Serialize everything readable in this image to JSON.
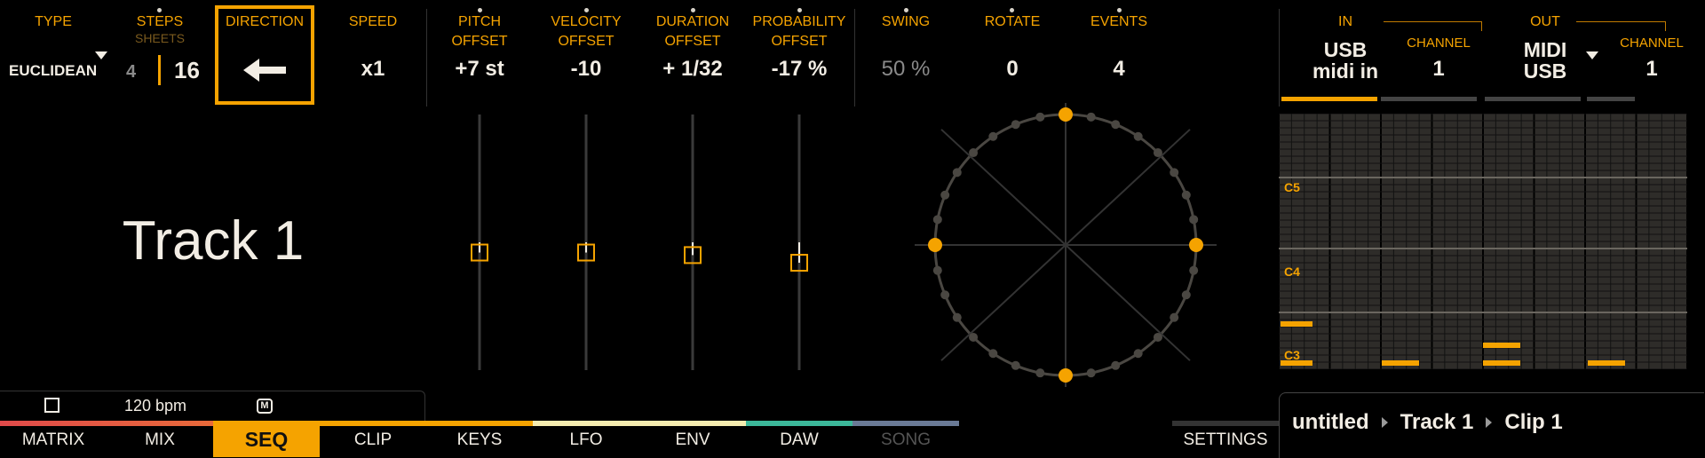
{
  "colors": {
    "accent": "#f5a300",
    "text": "#f2ede4",
    "dim": "#8a8a8a",
    "bg": "#000000"
  },
  "params": {
    "type": {
      "label": "TYPE",
      "value": "EUCLIDEAN"
    },
    "steps": {
      "label": "STEPS",
      "sublabel": "SHEETS",
      "sheets": "4",
      "steps": "16"
    },
    "direction": {
      "label": "DIRECTION",
      "icon": "arrow-left-icon"
    },
    "speed": {
      "label": "SPEED",
      "value": "x1"
    },
    "pitch": {
      "label1": "PITCH",
      "label2": "OFFSET",
      "value": "+7 st"
    },
    "velocity": {
      "label1": "VELOCITY",
      "label2": "OFFSET",
      "value": "-10"
    },
    "duration": {
      "label1": "DURATION",
      "label2": "OFFSET",
      "value": "+ 1/32"
    },
    "probability": {
      "label1": "PROBABILITY",
      "label2": "OFFSET",
      "value": "-17 %"
    },
    "swing": {
      "label": "SWING",
      "value": "50 %"
    },
    "rotate": {
      "label": "ROTATE",
      "value": "0"
    },
    "events": {
      "label": "EVENTS",
      "value": "4"
    }
  },
  "io": {
    "in_label": "IN",
    "in_value1": "USB",
    "in_value2": "midi in",
    "in_channel_label": "CHANNEL",
    "in_channel": "1",
    "out_label": "OUT",
    "out_value1": "MIDI",
    "out_value2": "USB",
    "out_channel_label": "CHANNEL",
    "out_channel": "1"
  },
  "track_name": "Track 1",
  "sliders": {
    "pitch_level": 0.46,
    "velocity_level": 0.46,
    "duration_level": 0.45,
    "probability_level": 0.42
  },
  "euclid": {
    "steps": 32,
    "events": 4
  },
  "piano_roll": {
    "labels": [
      "C5",
      "C4",
      "C3"
    ]
  },
  "transport": {
    "bpm": "120 bpm",
    "m_label": "M"
  },
  "nav": {
    "tabs": [
      "MATRIX",
      "MIX",
      "SEQ",
      "CLIP",
      "KEYS",
      "LFO",
      "ENV",
      "DAW",
      "SONG"
    ],
    "active": "SEQ",
    "settings": "SETTINGS"
  },
  "breadcrumb": {
    "project": "untitled",
    "track": "Track 1",
    "clip": "Clip 1"
  }
}
